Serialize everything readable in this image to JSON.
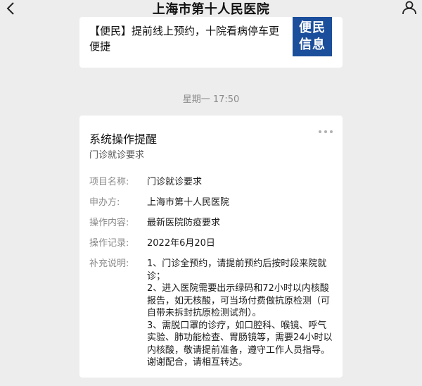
{
  "header": {
    "title": "上海市第十人民医院"
  },
  "article": {
    "text": "【便民】提前线上预约，十院看病停车更便捷",
    "thumb_line1": "便民",
    "thumb_line2": "信息"
  },
  "timestamp": "星期一 17:50",
  "notice": {
    "title": "系统操作提醒",
    "subtitle": "门诊就诊要求",
    "rows": [
      {
        "label": "项目名称:",
        "value": "门诊就诊要求"
      },
      {
        "label": "申办方:",
        "value": "上海市第十人民医院"
      },
      {
        "label": "操作内容:",
        "value": "最新医院防疫要求"
      },
      {
        "label": "操作记录:",
        "value": "2022年6月20日"
      },
      {
        "label": "补充说明:",
        "value": "1、门诊全预约，请提前预约后按时段来院就诊；\n2、进入医院需要出示绿码和72小时以内核酸报告，如无核酸，可当场付费做抗原检测（可自带未拆封抗原检测试剂）。\n3、需脱口罩的诊疗，如口腔科、喉镜、呼气实验、肺功能检查、胃肠镜等，需要24小时以内核酸，敬请提前准备，遵守工作人员指导。谢谢配合，请相互转达。"
      }
    ]
  },
  "colors": {
    "background": "#ededed",
    "card": "#ffffff",
    "thumb": "#1b4e9b"
  }
}
